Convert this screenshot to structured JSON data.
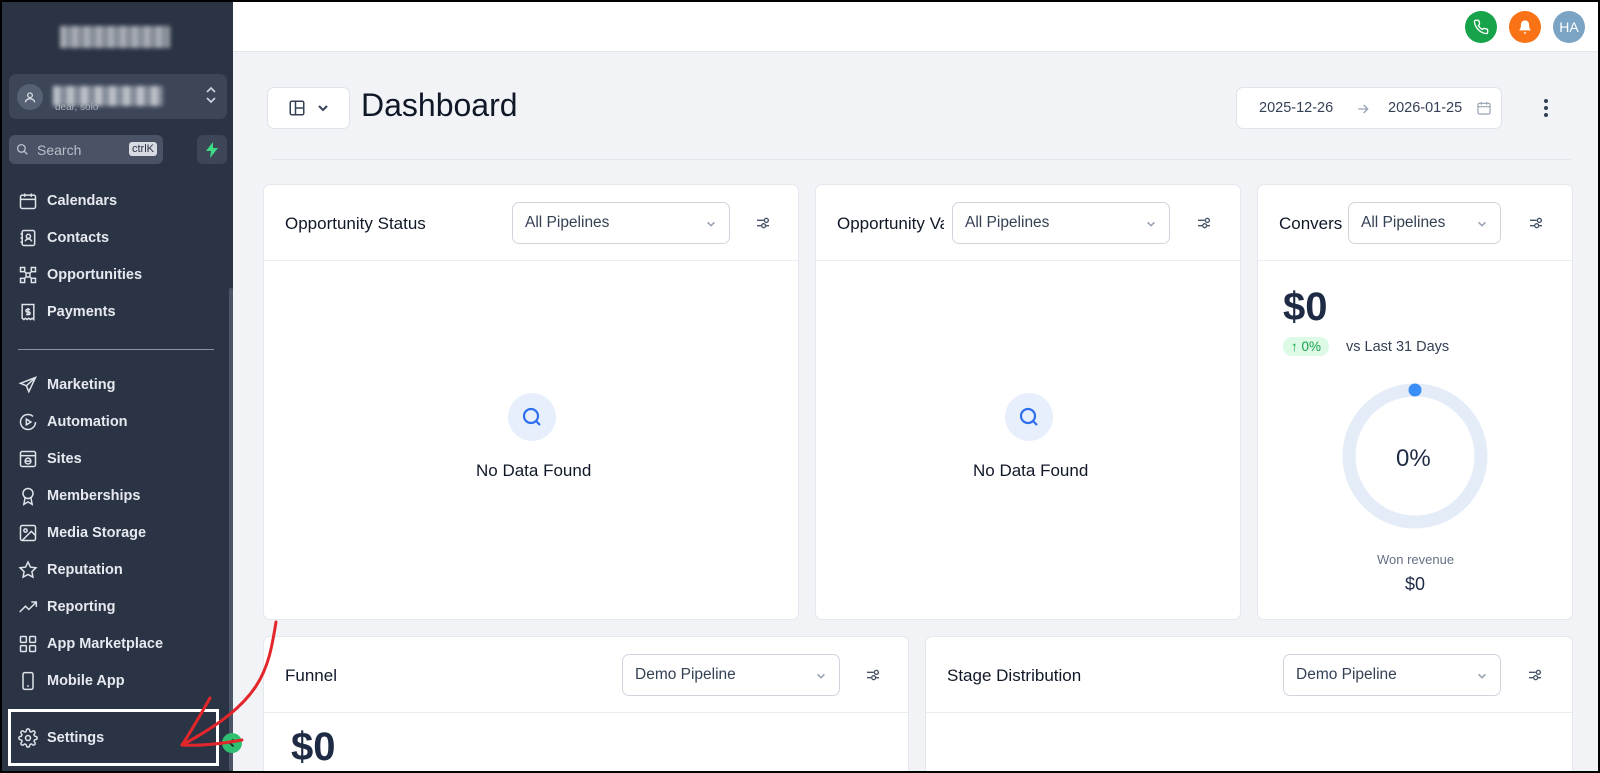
{
  "sidebar": {
    "account_sub": "dear, solo",
    "search": {
      "label": "Search",
      "shortcut": "ctrlK"
    },
    "items_top": [
      {
        "label": "Calendars",
        "icon": "calendar-icon"
      },
      {
        "label": "Contacts",
        "icon": "contacts-icon"
      },
      {
        "label": "Opportunities",
        "icon": "opportunities-icon"
      },
      {
        "label": "Payments",
        "icon": "payments-icon"
      }
    ],
    "items_bottom": [
      {
        "label": "Marketing",
        "icon": "send-icon"
      },
      {
        "label": "Automation",
        "icon": "automation-icon"
      },
      {
        "label": "Sites",
        "icon": "sites-icon"
      },
      {
        "label": "Memberships",
        "icon": "award-icon"
      },
      {
        "label": "Media Storage",
        "icon": "image-icon"
      },
      {
        "label": "Reputation",
        "icon": "star-icon"
      },
      {
        "label": "Reporting",
        "icon": "trending-icon"
      },
      {
        "label": "App Marketplace",
        "icon": "grid-icon"
      },
      {
        "label": "Mobile App",
        "icon": "mobile-icon"
      }
    ],
    "settings": "Settings"
  },
  "topbar": {
    "avatar_initials": "HA",
    "phone_color": "#16a34a",
    "bell_color": "#f97316",
    "avatar_color": "#7ba3c4"
  },
  "header": {
    "title": "Dashboard",
    "date_start": "2025-12-26",
    "date_end": "2026-01-25"
  },
  "cards": {
    "opportunity_status": {
      "title": "Opportunity Status",
      "pipeline": "All Pipelines",
      "empty": "No Data Found"
    },
    "opportunity_value": {
      "title": "Opportunity Value",
      "pipeline": "All Pipelines",
      "empty": "No Data Found"
    },
    "conversion": {
      "title": "Conversion Rate",
      "pipeline": "All Pipelines",
      "value": "$0",
      "change": "↑ 0%",
      "compare": "vs Last 31 Days",
      "rate_label": "0%",
      "rate": 0,
      "won_label": "Won revenue",
      "won_value": "$0"
    },
    "funnel": {
      "title": "Funnel",
      "pipeline": "Demo Pipeline",
      "value": "$0"
    },
    "stage_distribution": {
      "title": "Stage Distribution",
      "pipeline": "Demo Pipeline"
    }
  }
}
